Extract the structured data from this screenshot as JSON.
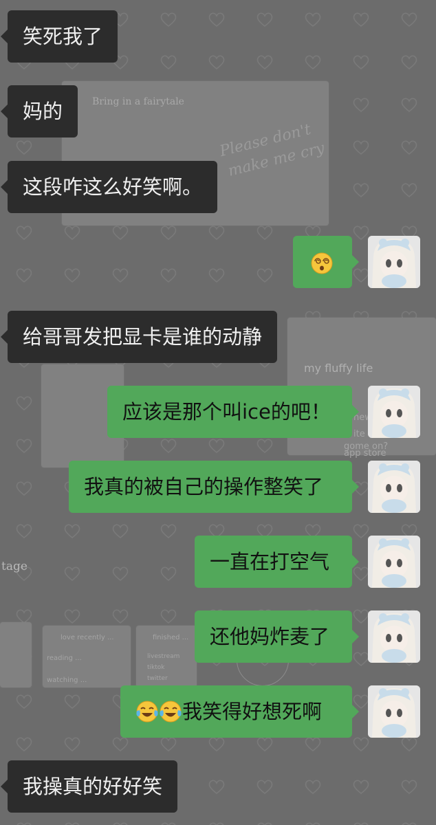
{
  "wallpaper": {
    "card_title": "Bring in a fairytale",
    "card_script_line1": "Please don't",
    "card_script_line2": "make me cry",
    "fluffy_label": "my fluffy life",
    "side_item_1": "new",
    "side_item_2": "ite",
    "side_item_3": "gome on?",
    "side_item_4": "app store",
    "stage_label": "tage",
    "panel_1_title": "love recently ...",
    "panel_2_title": "finished ...",
    "panel_1_line_1": "reading ...",
    "panel_1_line_2": "watching ...",
    "panel_2_line_1": "livestream",
    "panel_2_line_2": "tiktok",
    "panel_2_line_3": "twitter"
  },
  "messages": [
    {
      "side": "left",
      "text": "笑死我了"
    },
    {
      "side": "left",
      "text": "妈的"
    },
    {
      "side": "left",
      "text": "这段咋这么好笑啊。"
    },
    {
      "side": "right",
      "emoji": "dizzy-face",
      "text": ""
    },
    {
      "side": "left",
      "text": "给哥哥发把显卡是谁的动静"
    },
    {
      "side": "right",
      "text": "应该是那个叫ice的吧！"
    },
    {
      "side": "right",
      "text": "我真的被自己的操作整笑了"
    },
    {
      "side": "right",
      "text": "一直在打空气"
    },
    {
      "side": "right",
      "text": "还他妈炸麦了"
    },
    {
      "side": "right",
      "emoji": "tears-of-joy",
      "text": "我笑得好想死啊"
    },
    {
      "side": "left",
      "text": "我操真的好好笑"
    }
  ],
  "colors": {
    "left_bubble": "#2c2c2c",
    "right_bubble": "#52a85a",
    "background": "#6c6c6c"
  }
}
